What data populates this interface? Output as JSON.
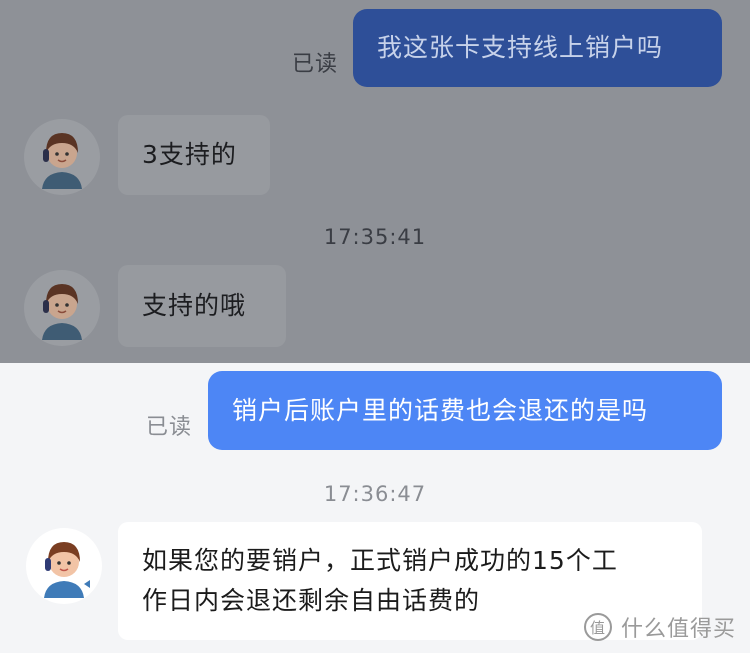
{
  "messages": [
    {
      "text": "我这张卡支持线上销户吗",
      "read_label": "已读"
    },
    {
      "text": "3支持的"
    },
    {
      "timestamp": "17:35:41"
    },
    {
      "text": "支持的哦"
    },
    {
      "text": "销户后账户里的话费也会退还的是吗",
      "read_label": "已读"
    },
    {
      "timestamp": "17:36:47"
    },
    {
      "line1": "如果您的要销户，正式销户成功的15个工",
      "line2": "作日内会退还剩余自由话费的"
    }
  ],
  "watermark": {
    "text": "什么值得买",
    "icon": "zhi-logo-icon"
  },
  "colors": {
    "dim_background": "#8e9197",
    "background": "#f4f5f7",
    "outgoing_bubble": "#4d86f5",
    "outgoing_bubble_dim": "#2e4f98",
    "incoming_bubble": "#ffffff",
    "incoming_bubble_dim": "#979a9f"
  }
}
